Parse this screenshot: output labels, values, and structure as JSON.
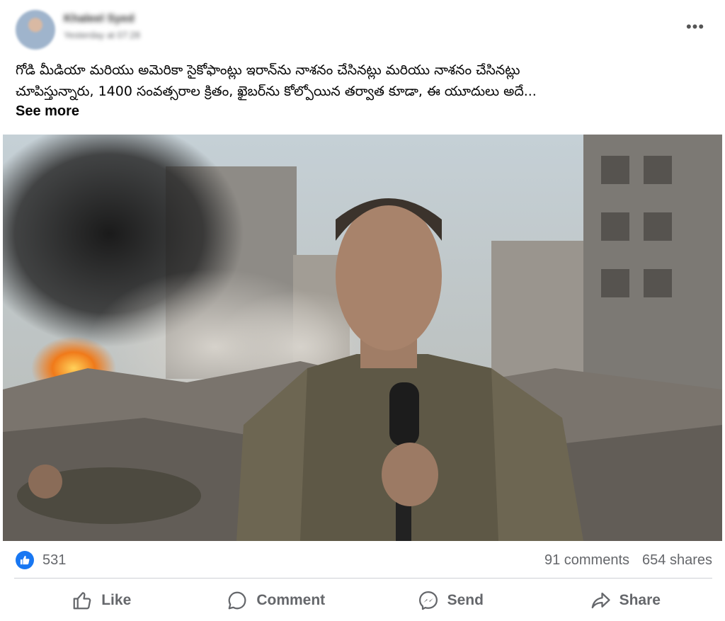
{
  "post": {
    "author_name": "Khaleel Syed",
    "timestamp": "Yesterday at 07:28",
    "more_icon": "more-horizontal-icon",
    "caption_lines": [
      "గోడి మీడియా మరియు అమెరికా సైకోఫాంట్లు ఇరాన్‌ను నాశనం చేసినట్లు మరియు నాశనం చేసినట్లు",
      "చూపిస్తున్నారు, 1400 సంవత్సరాల క్రితం, ఖైబర్‌ను కోల్పోయిన తర్వాత కూడా, ఈ యూదులు అదే..."
    ],
    "see_more": "See more"
  },
  "stats": {
    "like_icon": "like-thumb-icon",
    "like_count": "531",
    "comments": "91 comments",
    "shares": "654 shares"
  },
  "actions": {
    "like": "Like",
    "comment": "Comment",
    "send": "Send",
    "share": "Share"
  },
  "colors": {
    "accent": "#1877f2",
    "muted_text": "#65676b",
    "divider": "#ced0d4"
  }
}
